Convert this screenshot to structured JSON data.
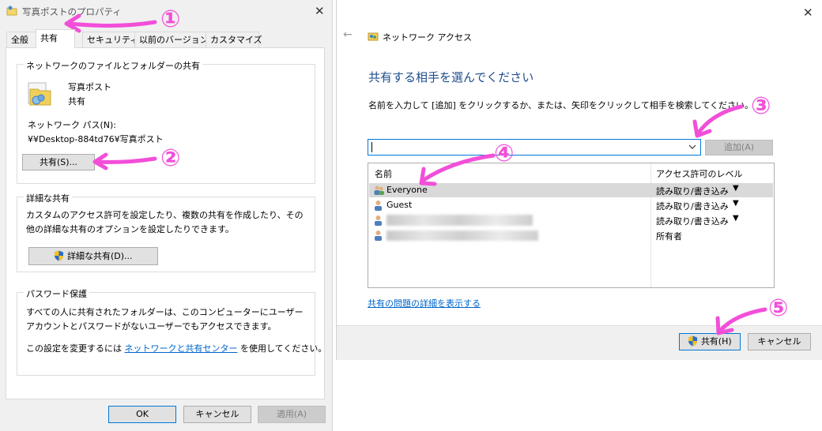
{
  "properties_dialog": {
    "title": "写真ポストのプロパティ",
    "tabs": [
      "全般",
      "共有",
      "セキュリティ",
      "以前のバージョン",
      "カスタマイズ"
    ],
    "active_tab": "共有",
    "network_share_group": {
      "label": "ネットワークのファイルとフォルダーの共有",
      "folder_name": "写真ポスト",
      "share_status": "共有",
      "path_label": "ネットワーク パス(N):",
      "path_value": "¥¥Desktop-884td76¥写真ポスト",
      "share_button": "共有(S)..."
    },
    "advanced_group": {
      "label": "詳細な共有",
      "description": "カスタムのアクセス許可を設定したり、複数の共有を作成したり、その他の詳細な共有のオプションを設定したりできます。",
      "button": "詳細な共有(D)..."
    },
    "password_group": {
      "label": "パスワード保護",
      "description": "すべての人に共有されたフォルダーは、このコンピューターにユーザー アカウントとパスワードがないユーザーでもアクセスできます。",
      "change_prefix": "この設定を変更するには",
      "change_link": "ネットワークと共有センター",
      "change_suffix": "を使用してください。"
    },
    "buttons": {
      "ok": "OK",
      "cancel": "キャンセル",
      "apply": "適用(A)"
    }
  },
  "network_access_dialog": {
    "title": "ネットワーク アクセス",
    "heading": "共有する相手を選んでください",
    "instruction": "名前を入力して [追加] をクリックするか、または、矢印をクリックして相手を検索してください。",
    "combo_value": "",
    "add_button": "追加(A)",
    "columns": [
      "名前",
      "アクセス許可のレベル"
    ],
    "rows": [
      {
        "name": "Everyone",
        "permission": "読み取り/書き込み",
        "has_dropdown": true,
        "selected": true
      },
      {
        "name": "Guest",
        "permission": "読み取り/書き込み",
        "has_dropdown": true,
        "selected": false
      },
      {
        "name": "",
        "permission": "読み取り/書き込み",
        "has_dropdown": true,
        "selected": false
      },
      {
        "name": "",
        "permission": "所有者",
        "has_dropdown": false,
        "selected": false
      }
    ],
    "help_link": "共有の問題の詳細を表示する",
    "share_button": "共有(H)",
    "cancel_button": "キャンセル"
  },
  "annotations": [
    "①",
    "②",
    "③",
    "④",
    "⑤"
  ],
  "colors": {
    "annotation": "#f24fd9",
    "link": "#0066cc",
    "heading": "#1f4e8c",
    "focus": "#0078d7"
  }
}
